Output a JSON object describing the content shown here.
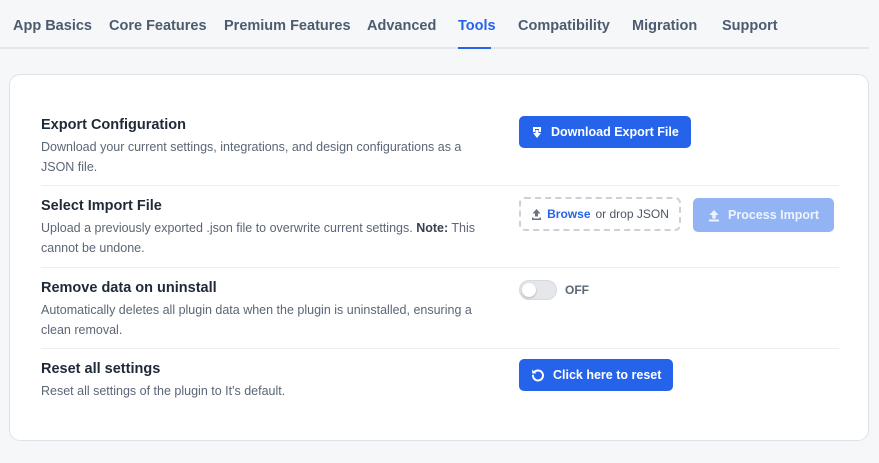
{
  "tabs": [
    {
      "label": "App Basics"
    },
    {
      "label": "Core Features"
    },
    {
      "label": "Premium Features"
    },
    {
      "label": "Advanced"
    },
    {
      "label": "Tools"
    },
    {
      "label": "Compatibility"
    },
    {
      "label": "Migration"
    },
    {
      "label": "Support"
    }
  ],
  "active_tab": "Tools",
  "export": {
    "title": "Export Configuration",
    "description": "Download your current settings, integrations, and design configurations as a JSON file.",
    "button_label": "Download Export File",
    "button_icon": "download-icon"
  },
  "import": {
    "title": "Select Import File",
    "description_start": "Upload a previously exported .json file to overwrite current settings.",
    "note_label": "Note:",
    "description_end": "This cannot be undone.",
    "browse_label": "Browse",
    "drop_label": "or drop JSON",
    "dropzone_icon": "upload-icon",
    "process_button_label": "Process Import",
    "process_button_icon": "upload-icon"
  },
  "uninstall": {
    "title": "Remove data on uninstall",
    "description": "Automatically deletes all plugin data when the plugin is uninstalled, ensuring a clean removal.",
    "toggle_state": "OFF"
  },
  "reset": {
    "title": "Reset all settings",
    "description": "Reset all settings of the plugin to It's default.",
    "button_label": "Click here to reset",
    "button_icon": "reset-icon"
  },
  "colors": {
    "accent": "#2563eb",
    "accent_disabled": "#93b4f4",
    "tab_text": "#4d5b70",
    "background": "#f6f7f9"
  }
}
